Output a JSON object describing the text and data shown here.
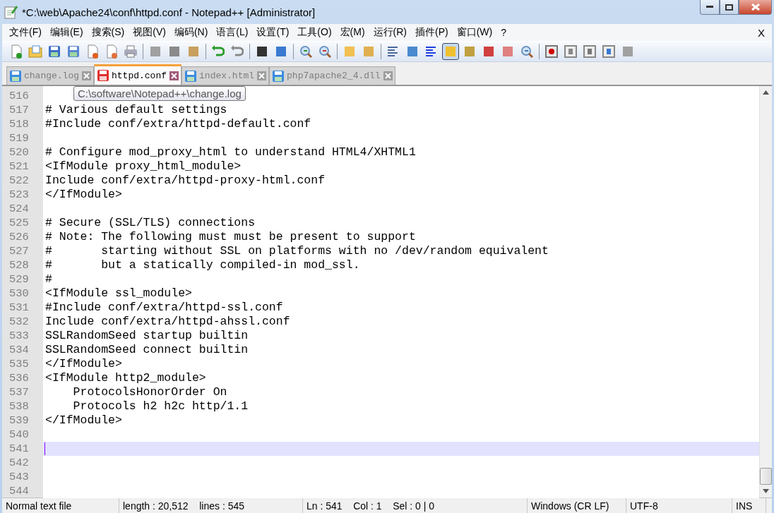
{
  "window": {
    "title": "*C:\\web\\Apache24\\conf\\httpd.conf - Notepad++ [Administrator]"
  },
  "menu": {
    "items": [
      "文件(F)",
      "编辑(E)",
      "搜索(S)",
      "视图(V)",
      "编码(N)",
      "语言(L)",
      "设置(T)",
      "工具(O)",
      "宏(M)",
      "运行(R)",
      "插件(P)",
      "窗口(W)",
      "?"
    ],
    "close": "X"
  },
  "toolbar": [
    {
      "selected": false
    },
    {
      "selected": false
    },
    {
      "selected": false
    },
    {
      "selected": false
    },
    {
      "selected": false
    },
    {
      "selected": false
    },
    {
      "selected": false
    },
    {
      "selected": false
    },
    {
      "selected": false
    },
    {
      "selected": false
    },
    {
      "selected": false
    },
    {
      "selected": false
    },
    {
      "selected": false
    },
    {
      "selected": false
    },
    {
      "selected": false
    },
    {
      "selected": false
    },
    {
      "selected": false
    },
    {
      "selected": false
    },
    {
      "selected": false
    },
    {
      "selected": false
    },
    {
      "selected": false
    },
    {
      "selected": true
    },
    {
      "selected": false
    },
    {
      "selected": false
    },
    {
      "selected": false
    },
    {
      "selected": false
    },
    {
      "selected": false
    },
    {
      "selected": false
    },
    {
      "selected": false
    },
    {
      "selected": false
    },
    {
      "selected": false
    }
  ],
  "tabs": [
    {
      "label": "change.log",
      "selected": false,
      "modified": false
    },
    {
      "label": "httpd.conf",
      "selected": true,
      "modified": true
    },
    {
      "label": "index.html",
      "selected": false,
      "modified": false
    },
    {
      "label": "php7apache2_4.dll",
      "selected": false,
      "modified": false
    }
  ],
  "tooltip": "C:\\software\\Notepad++\\change.log",
  "lines": [
    {
      "number": "516",
      "current": false
    },
    {
      "number": "517",
      "text": "# Various default settings",
      "current": false
    },
    {
      "number": "518",
      "text": "#Include conf/extra/httpd-default.conf",
      "current": false
    },
    {
      "number": "519",
      "current": false
    },
    {
      "number": "520",
      "text": "# Configure mod_proxy_html to understand HTML4/XHTML1",
      "current": false
    },
    {
      "number": "521",
      "text": "<IfModule proxy_html_module>",
      "current": false
    },
    {
      "number": "522",
      "text": "Include conf/extra/httpd-proxy-html.conf",
      "current": false
    },
    {
      "number": "523",
      "text": "</IfModule>",
      "current": false
    },
    {
      "number": "524",
      "current": false
    },
    {
      "number": "525",
      "text": "# Secure (SSL/TLS) connections",
      "current": false
    },
    {
      "number": "526",
      "text": "# Note: The following must must be present to support",
      "current": false
    },
    {
      "number": "527",
      "text": "#       starting without SSL on platforms with no /dev/random equivalent",
      "current": false
    },
    {
      "number": "528",
      "text": "#       but a statically compiled-in mod_ssl.",
      "current": false
    },
    {
      "number": "529",
      "text": "#",
      "current": false
    },
    {
      "number": "530",
      "text": "<IfModule ssl_module>",
      "current": false
    },
    {
      "number": "531",
      "text": "#Include conf/extra/httpd-ssl.conf",
      "current": false
    },
    {
      "number": "532",
      "text": "Include conf/extra/httpd-ahssl.conf",
      "current": false
    },
    {
      "number": "533",
      "text": "SSLRandomSeed startup builtin",
      "current": false
    },
    {
      "number": "534",
      "text": "SSLRandomSeed connect builtin",
      "current": false
    },
    {
      "number": "535",
      "text": "</IfModule>",
      "current": false
    },
    {
      "number": "536",
      "text": "<IfModule http2_module>",
      "current": false
    },
    {
      "number": "537",
      "text": "    ProtocolsHonorOrder On",
      "current": false
    },
    {
      "number": "538",
      "text": "    Protocols h2 h2c http/1.1",
      "current": false
    },
    {
      "number": "539",
      "text": "</IfModule>",
      "current": false
    },
    {
      "number": "540",
      "current": false
    },
    {
      "number": "541",
      "current": true
    },
    {
      "number": "542",
      "current": false
    },
    {
      "number": "543",
      "current": false
    },
    {
      "number": "544",
      "current": false
    }
  ],
  "status_bar": [
    "Normal text file",
    "length : 20,512    lines : 545",
    "Ln : 541    Col : 1    Sel : 0 | 0",
    "Windows (CR LF)",
    "UTF-8",
    "INS"
  ]
}
